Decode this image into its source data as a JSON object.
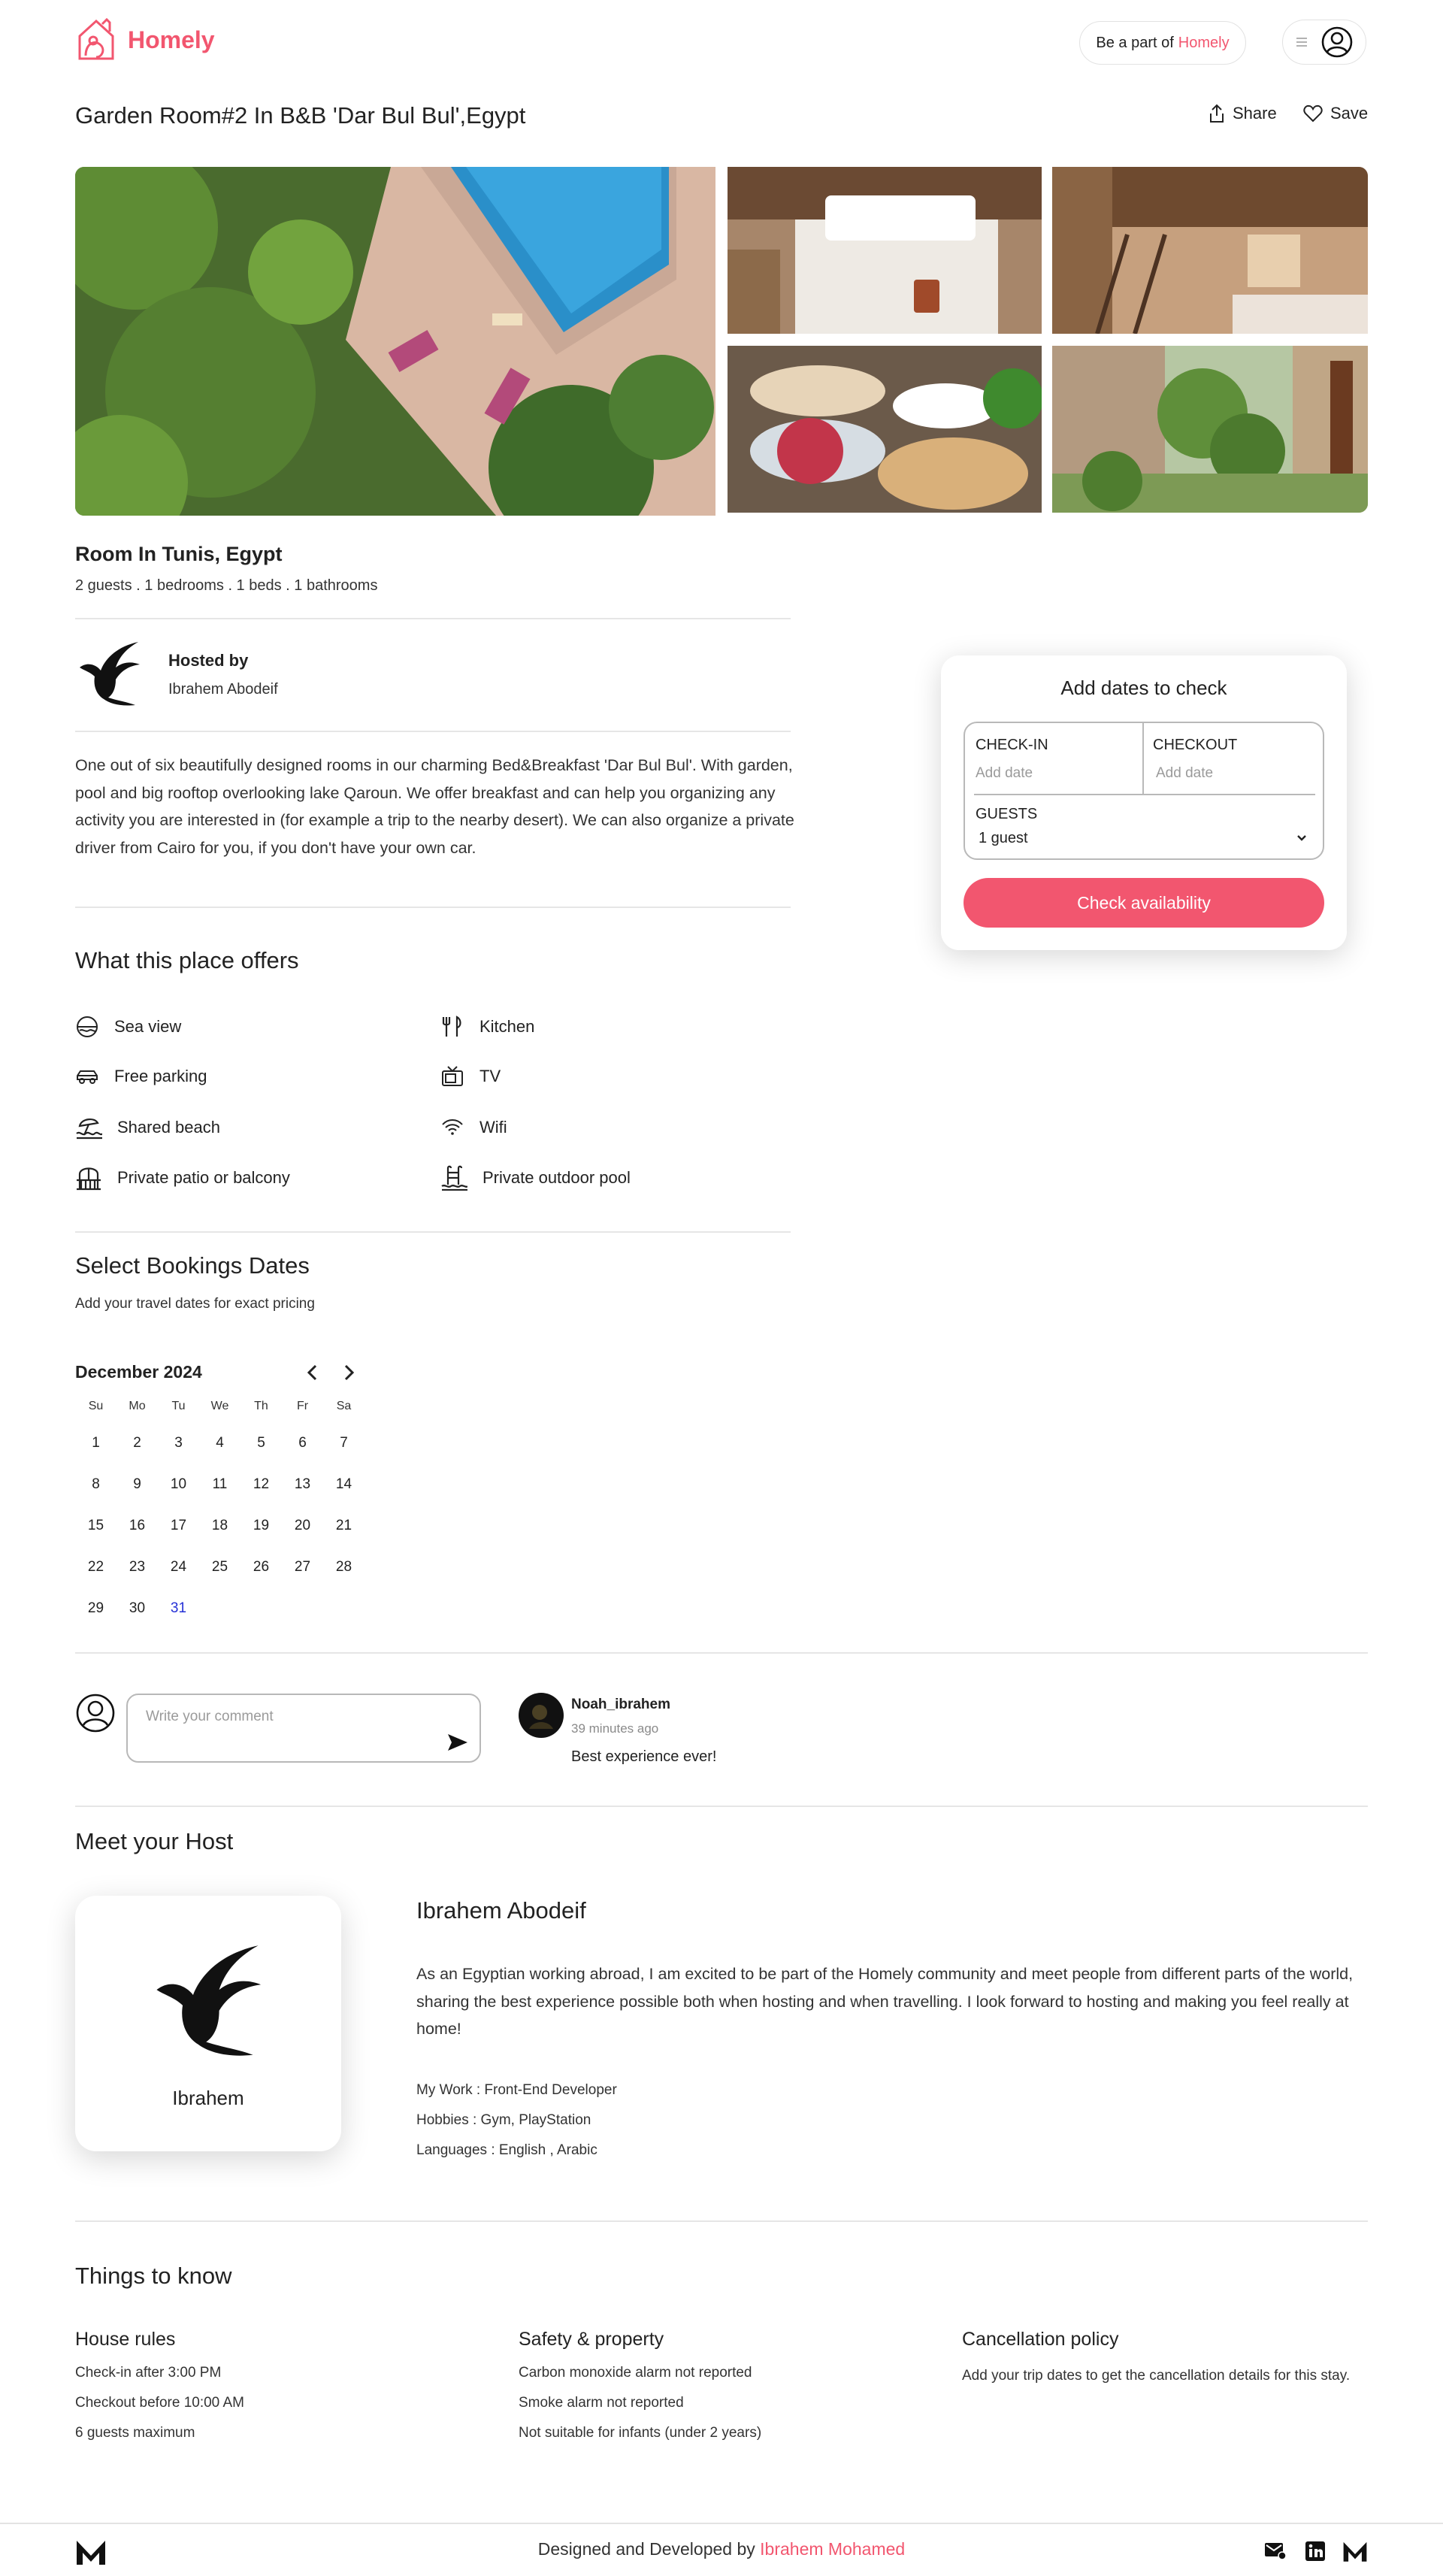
{
  "header": {
    "brand": "Homely",
    "be_part_prefix": "Be a part of",
    "be_part_brand": "Homely"
  },
  "listing": {
    "title": "Garden Room#2 In B&B 'Dar Bul Bul',Egypt",
    "share_label": "Share",
    "save_label": "Save",
    "room_title": "Room In Tunis, Egypt",
    "room_summary": "2 guests . 1 bedrooms . 1 beds . 1 bathrooms",
    "hosted_by_label": "Hosted by",
    "host_name": "Ibrahem Abodeif",
    "description": "One out of six beautifully designed rooms in our charming Bed&Breakfast 'Dar Bul Bul'. With garden, pool and big rooftop overlooking lake Qaroun. We offer breakfast and can help you organizing any activity you are interested in (for example a trip to the nearby desert). We can also organize a private driver from Cairo for you, if you don't have your own car."
  },
  "offers": {
    "title": "What this place offers",
    "items": [
      {
        "label": "Sea view",
        "icon": "sea-view-icon"
      },
      {
        "label": "Kitchen",
        "icon": "kitchen-icon"
      },
      {
        "label": "Free parking",
        "icon": "car-icon"
      },
      {
        "label": "TV",
        "icon": "tv-icon"
      },
      {
        "label": "Shared beach",
        "icon": "beach-icon"
      },
      {
        "label": "Wifi",
        "icon": "wifi-icon"
      },
      {
        "label": "Private patio or balcony",
        "icon": "balcony-icon"
      },
      {
        "label": "Private outdoor pool",
        "icon": "pool-icon"
      }
    ]
  },
  "booking_dates": {
    "title": "Select Bookings Dates",
    "subtitle": "Add your travel dates for exact pricing",
    "month": "December 2024",
    "weekdays": [
      "Su",
      "Mo",
      "Tu",
      "We",
      "Th",
      "Fr",
      "Sa"
    ],
    "days": [
      "1",
      "2",
      "3",
      "4",
      "5",
      "6",
      "7",
      "8",
      "9",
      "10",
      "11",
      "12",
      "13",
      "14",
      "15",
      "16",
      "17",
      "18",
      "19",
      "20",
      "21",
      "22",
      "23",
      "24",
      "25",
      "26",
      "27",
      "28",
      "29",
      "30",
      "31"
    ],
    "today": "31"
  },
  "booking_card": {
    "title": "Add dates to check",
    "checkin_label": "CHECK-IN",
    "checkin_placeholder": "Add date",
    "checkout_label": "CHECKOUT",
    "checkout_placeholder": "Add date",
    "guests_label": "GUESTS",
    "guests_value": "1 guest",
    "button": "Check availability"
  },
  "comments": {
    "input_placeholder": "Write your comment",
    "items": [
      {
        "author": "Noah_ibrahem",
        "time": "39 minutes ago",
        "text": "Best experience ever!"
      }
    ]
  },
  "meet_host": {
    "title": "Meet your Host",
    "card_name": "Ibrahem",
    "full_name": "Ibrahem Abodeif",
    "bio": "As an Egyptian working abroad, I am excited to be part of the Homely community and meet people from different parts of the world, sharing the best experience possible both when hosting and when travelling. I look forward to hosting and making you feel really at home!",
    "work": "My Work : Front-End Developer",
    "hobbies": "Hobbies : Gym, PlayStation",
    "languages": "Languages : English , Arabic"
  },
  "things_to_know": {
    "title": "Things to know",
    "house_rules": {
      "title": "House rules",
      "lines": [
        "Check-in after 3:00 PM",
        "Checkout before 10:00 AM",
        "6 guests maximum"
      ]
    },
    "safety": {
      "title": "Safety & property",
      "lines": [
        "Carbon monoxide alarm not reported",
        "Smoke alarm not reported",
        "Not suitable for infants (under 2 years)"
      ]
    },
    "cancellation": {
      "title": "Cancellation policy",
      "text": "Add your trip dates to get the cancellation details for this stay."
    }
  },
  "footer": {
    "prefix": "Designed and Developed by",
    "author": "Ibrahem Mohamed"
  },
  "colors": {
    "brand": "#f2566f",
    "today": "#2530d6"
  }
}
